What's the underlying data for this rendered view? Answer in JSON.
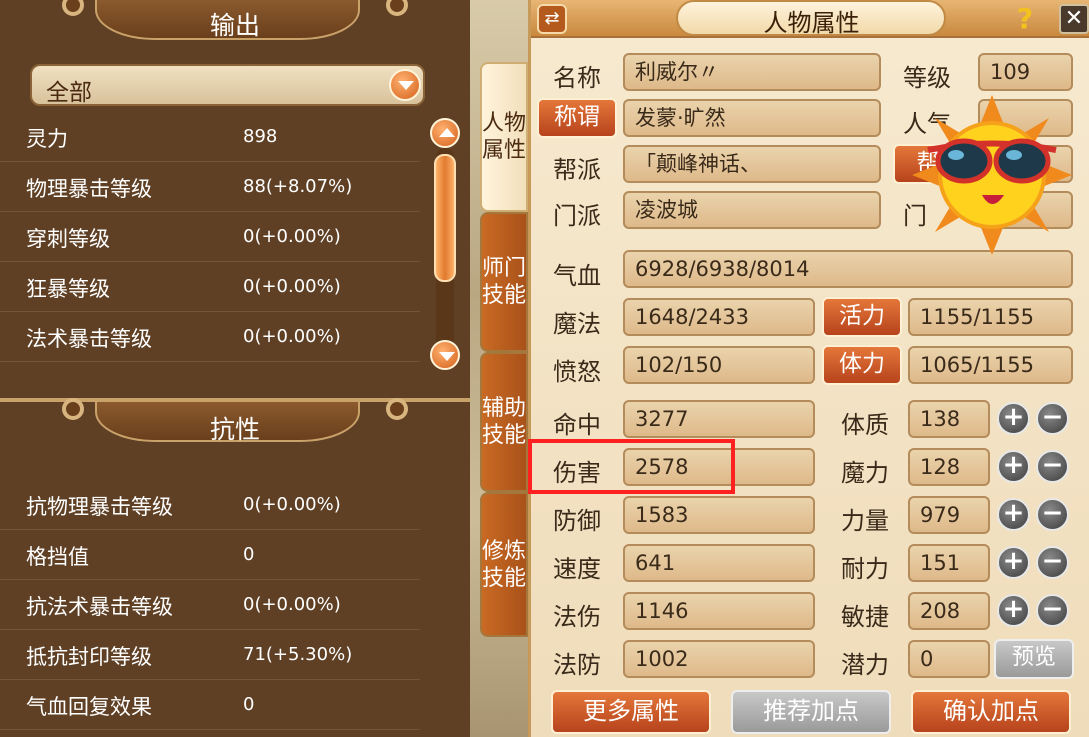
{
  "output_section": {
    "title": "输出",
    "filter_selected": "全部",
    "stats": [
      {
        "label": "灵力",
        "value": "898"
      },
      {
        "label": "物理暴击等级",
        "value": "88(+8.07%)"
      },
      {
        "label": "穿刺等级",
        "value": "0(+0.00%)"
      },
      {
        "label": "狂暴等级",
        "value": "0(+0.00%)"
      },
      {
        "label": "法术暴击等级",
        "value": "0(+0.00%)"
      }
    ]
  },
  "resist_section": {
    "title": "抗性",
    "stats": [
      {
        "label": "抗物理暴击等级",
        "value": "0(+0.00%)"
      },
      {
        "label": "格挡值",
        "value": "0"
      },
      {
        "label": "抗法术暴击等级",
        "value": "0(+0.00%)"
      },
      {
        "label": "抵抗封印等级",
        "value": "71(+5.30%)"
      },
      {
        "label": "气血回复效果",
        "value": "0"
      }
    ]
  },
  "tabs": [
    "人物属性",
    "师门技能",
    "辅助技能",
    "修炼技能"
  ],
  "window": {
    "title": "人物属性",
    "help_icon": "?",
    "swap_icon": "⇄",
    "close_icon": "✕"
  },
  "profile": {
    "name_label": "名称",
    "name_value": "利威尔〃",
    "level_label": "等级",
    "level_value": "109",
    "title_button": "称谓",
    "title_value": "发蒙·旷然",
    "popularity_label": "人气",
    "guild_label": "帮派",
    "guild_value": "「颠峰神话、",
    "guild_button": "帮",
    "sect_label": "门派",
    "sect_value": "凌波城",
    "faction_label": "门"
  },
  "vitals": {
    "hp_label": "气血",
    "hp_value": "6928/6938/8014",
    "mp_label": "魔法",
    "mp_value": "1648/2433",
    "vigor_button": "活力",
    "vigor_value": "1155/1155",
    "rage_label": "愤怒",
    "rage_value": "102/150",
    "stamina_button": "体力",
    "stamina_value": "1065/1155"
  },
  "combat": [
    {
      "label": "命中",
      "value": "3277"
    },
    {
      "label": "伤害",
      "value": "2578"
    },
    {
      "label": "防御",
      "value": "1583"
    },
    {
      "label": "速度",
      "value": "641"
    },
    {
      "label": "法伤",
      "value": "1146"
    },
    {
      "label": "法防",
      "value": "1002"
    }
  ],
  "attributes": [
    {
      "label": "体质",
      "value": "138"
    },
    {
      "label": "魔力",
      "value": "128"
    },
    {
      "label": "力量",
      "value": "979"
    },
    {
      "label": "耐力",
      "value": "151"
    },
    {
      "label": "敏捷",
      "value": "208"
    }
  ],
  "potential": {
    "label": "潜力",
    "value": "0",
    "preview_button": "预览"
  },
  "buttons": {
    "more": "更多属性",
    "recommend": "推荐加点",
    "confirm": "确认加点"
  },
  "plus_glyph": "+",
  "minus_glyph": "−",
  "colors": {
    "accent_orange": "#c9541e",
    "highlight_red": "#ff2020",
    "panel_brown": "#56361c"
  }
}
